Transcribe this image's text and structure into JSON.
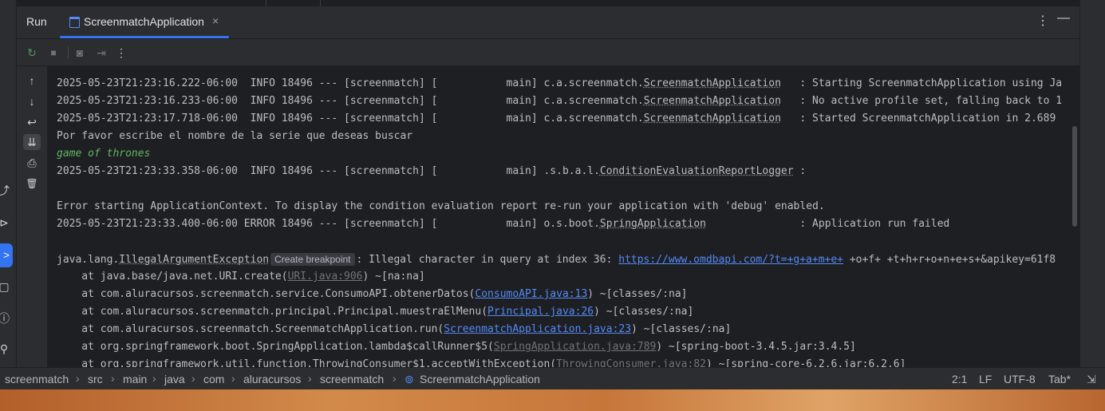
{
  "tool_window": {
    "title": "Run",
    "tab_label": "ScreenmatchApplication",
    "tab_close": "×",
    "more_icon": "⋮",
    "minimize_icon": "—"
  },
  "toolbar": {
    "rerun": "↻",
    "stop": "■",
    "screenshot": "◙",
    "exit": "⇥",
    "more": "⋮"
  },
  "side_actions": {
    "up": "↑",
    "down": "↓",
    "soft_wrap": "↩",
    "scroll_to_end": "⇊",
    "print": "⎙",
    "clear": "🗑"
  },
  "console": {
    "lines": [
      {
        "pre": "2025-05-23T21:23:16.222-06:00  INFO 18496 --- [screenmatch] [           main] c.a.screenmatch.",
        "ul": "ScreenmatchApplication",
        "post": "   : Starting ScreenmatchApplication using Ja"
      },
      {
        "pre": "2025-05-23T21:23:16.233-06:00  INFO 18496 --- [screenmatch] [           main] c.a.screenmatch.",
        "ul": "ScreenmatchApplication",
        "post": "   : No active profile set, falling back to 1"
      },
      {
        "pre": "2025-05-23T21:23:17.718-06:00  INFO 18496 --- [screenmatch] [           main] c.a.screenmatch.",
        "ul": "ScreenmatchApplication",
        "post": "   : Started ScreenmatchApplication in 2.689"
      },
      {
        "text": "Por favor escribe el nombre de la serie que deseas buscar"
      },
      {
        "input": "game of thrones"
      },
      {
        "pre": "2025-05-23T21:23:33.358-06:00  INFO 18496 --- [screenmatch] [           main] .s.b.a.l.",
        "ul": "ConditionEvaluationReportLogger",
        "post": " :"
      },
      {
        "text": ""
      },
      {
        "text": "Error starting ApplicationContext. To display the condition evaluation report re-run your application with 'debug' enabled."
      },
      {
        "pre": "2025-05-23T21:23:33.400-06:00 ERROR 18496 --- [screenmatch] [           main] o.s.boot.",
        "ul": "SpringApplication",
        "post": "               : Application run failed"
      },
      {
        "text": ""
      },
      {
        "pre": "java.lang.",
        "ul": "IllegalArgumentException",
        "bp": "Create breakpoint",
        "post2": ": Illegal character in query at index 36: ",
        "link": "https://www.omdbapi.com/?t=+g+a+m+e+",
        "tail": " +o+f+ +t+h+r+o+n+e+s+&apikey=61f8"
      },
      {
        "st_pre": "    at java.base/java.net.URI.create(",
        "st_link": "URI.java:906",
        "grey": true,
        "st_post": ") ~[na:na]"
      },
      {
        "st_pre": "    at com.aluracursos.screenmatch.service.ConsumoAPI.obtenerDatos(",
        "st_link": "ConsumoAPI.java:13",
        "grey": false,
        "st_post": ") ~[classes/:na]"
      },
      {
        "st_pre": "    at com.aluracursos.screenmatch.principal.Principal.muestraElMenu(",
        "st_link": "Principal.java:26",
        "grey": false,
        "st_post": ") ~[classes/:na]"
      },
      {
        "st_pre": "    at com.aluracursos.screenmatch.ScreenmatchApplication.run(",
        "st_link": "ScreenmatchApplication.java:23",
        "grey": false,
        "st_post": ") ~[classes/:na]"
      },
      {
        "st_pre": "    at org.springframework.boot.SpringApplication.lambda$callRunner$5(",
        "st_link": "SpringApplication.java:789",
        "grey": true,
        "st_post": ") ~[spring-boot-3.4.5.jar:3.4.5]"
      },
      {
        "st_pre": "    at org.springframework.util.function.ThrowingConsumer$1.acceptWithException(",
        "st_link": "ThrowingConsumer.java:82",
        "grey": true,
        "st_post": ") ~[spring-core-6.2.6.jar:6.2.6]"
      }
    ]
  },
  "breadcrumbs": [
    "screenmatch",
    "src",
    "main",
    "java",
    "com",
    "aluracursos",
    "screenmatch",
    "ScreenmatchApplication"
  ],
  "status": {
    "position": "2:1",
    "line_separator": "LF",
    "encoding": "UTF-8",
    "indent": "Tab*"
  },
  "colors": {
    "accent": "#3574f0",
    "link": "#548af7",
    "user_input": "#5fb865"
  }
}
